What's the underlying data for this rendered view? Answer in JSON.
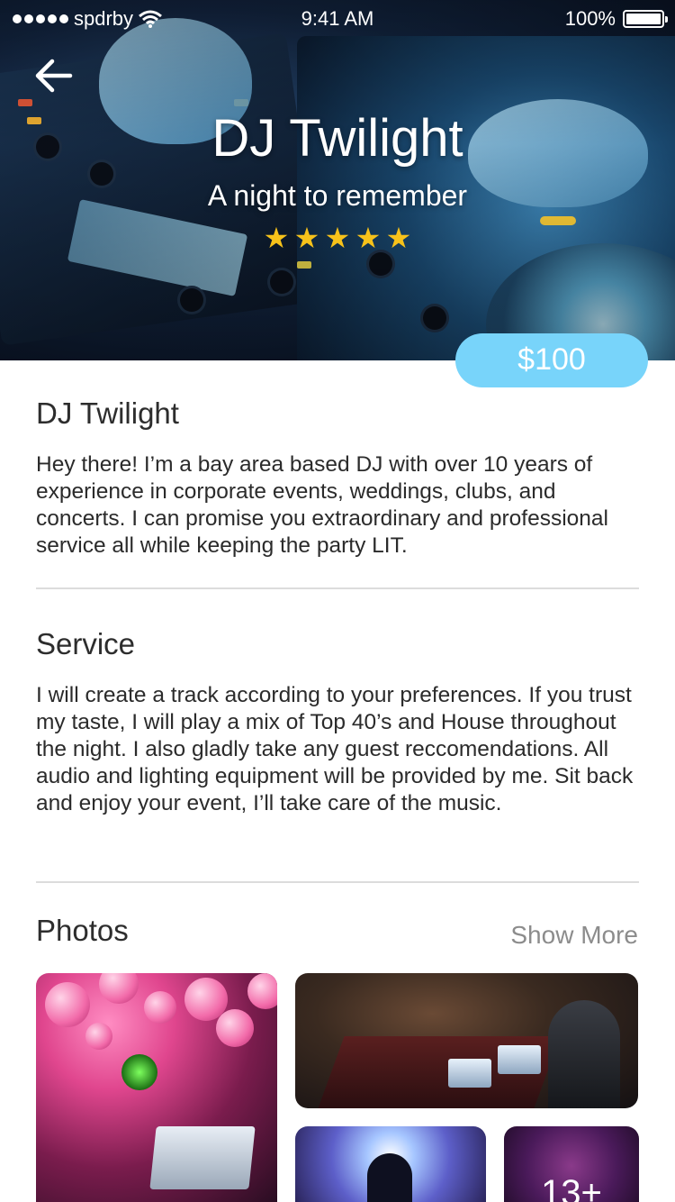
{
  "status_bar": {
    "carrier": "spdrby",
    "time": "9:41 AM",
    "battery": "100%"
  },
  "hero": {
    "title": "DJ Twilight",
    "subtitle": "A night to remember",
    "rating": 5,
    "price": "$100"
  },
  "about": {
    "title": "DJ Twilight",
    "body": "Hey there! I’m a bay area based DJ with over 10 years of experience in corporate events, weddings, clubs, and concerts. I can promise you extraordinary and professional service all while keeping the party LIT."
  },
  "service": {
    "title": "Service",
    "body": "I will create a track according to your preferences. If you trust my taste, I will play a mix of Top 40’s and House throughout the night. I also gladly take any guest reccomendations. All audio and lighting equipment will be provided by me. Sit back and enjoy your event, I’ll take care of the music."
  },
  "photos": {
    "title": "Photos",
    "show_more": "Show More",
    "more_count": "13+"
  },
  "colors": {
    "accent": "#78d4fa",
    "star": "#f7c21a",
    "divider": "#dcdcdc"
  },
  "icons": {
    "back": "arrow-left-icon",
    "wifi": "wifi-icon",
    "battery": "battery-icon",
    "star": "star-icon"
  }
}
